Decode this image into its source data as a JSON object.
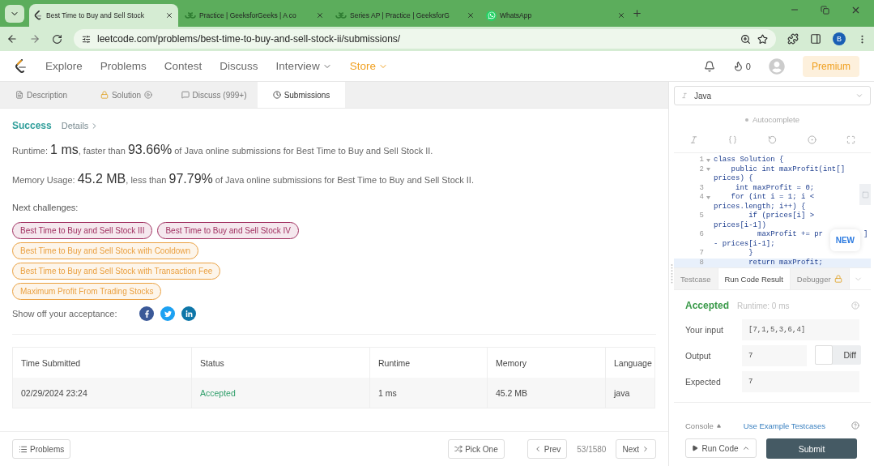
{
  "browser": {
    "tabs": [
      {
        "title": "Best Time to Buy and Sell Stock",
        "kind": "leetcode",
        "selected": true
      },
      {
        "title": "Practice | GeeksforGeeks | A co",
        "kind": "gfg",
        "selected": false
      },
      {
        "title": "Series AP | Practice | GeeksforG",
        "kind": "gfg",
        "selected": false
      },
      {
        "title": "WhatsApp",
        "kind": "whatsapp",
        "selected": false
      }
    ],
    "url": "leetcode.com/problems/best-time-to-buy-and-sell-stock-ii/submissions/",
    "profile": "B"
  },
  "nav": {
    "items": [
      {
        "label": "Explore",
        "dropdown": false,
        "featured": false
      },
      {
        "label": "Problems",
        "dropdown": false,
        "featured": false
      },
      {
        "label": "Contest",
        "dropdown": false,
        "featured": false
      },
      {
        "label": "Discuss",
        "dropdown": false,
        "featured": false
      },
      {
        "label": "Interview",
        "dropdown": true,
        "featured": false
      },
      {
        "label": "Store",
        "dropdown": true,
        "featured": true
      }
    ],
    "streak": "0",
    "premium": "Premium"
  },
  "panel_tabs": [
    {
      "label": "Description",
      "kind": "description",
      "selected": false
    },
    {
      "label": "Solution",
      "kind": "solution",
      "selected": false
    },
    {
      "label": "Discuss (999+)",
      "kind": "discuss",
      "selected": false
    },
    {
      "label": "Submissions",
      "kind": "submissions",
      "selected": true
    }
  ],
  "result": {
    "status": "Success",
    "details": "Details",
    "lines": [
      [
        {
          "text": "Runtime: ",
          "big": false
        },
        {
          "text": "1 ms",
          "big": true
        },
        {
          "text": ", faster than ",
          "big": false
        },
        {
          "text": "93.66%",
          "big": true
        },
        {
          "text": " of Java online submissions for Best Time to Buy and Sell Stock II.",
          "big": false
        }
      ],
      [
        {
          "text": "Memory Usage: ",
          "big": false
        },
        {
          "text": "45.2 MB",
          "big": true
        },
        {
          "text": ", less than ",
          "big": false
        },
        {
          "text": "97.79%",
          "big": true
        },
        {
          "text": " of Java online submissions for Best Time to Buy and Sell Stock II.",
          "big": false
        }
      ]
    ],
    "next_label": "Next challenges:",
    "challenges": [
      {
        "title": "Best Time to Buy and Sell Stock III",
        "color": "#a03060"
      },
      {
        "title": "Best Time to Buy and Sell Stock IV",
        "color": "#a03060"
      },
      {
        "title": "Best Time to Buy and Sell Stock with Cooldown",
        "color": "#eaa040"
      },
      {
        "title": "Best Time to Buy and Sell Stock with Transaction Fee",
        "color": "#eaa040"
      },
      {
        "title": "Maximum Profit From Trading Stocks",
        "color": "#eaa040"
      }
    ],
    "share_label": "Show off your acceptance:",
    "share": [
      {
        "kind": "facebook"
      },
      {
        "kind": "twitter"
      },
      {
        "kind": "linkedin"
      }
    ]
  },
  "table": {
    "columns": [
      "Time Submitted",
      "Status",
      "Runtime",
      "Memory",
      "Language"
    ],
    "rows": [
      {
        "time": "02/29/2024 23:24",
        "status": "Accepted",
        "runtime": "1 ms",
        "memory": "45.2 MB",
        "language": "java"
      }
    ]
  },
  "footer": {
    "problems": "Problems",
    "pick": "Pick One",
    "prev": "Prev",
    "counter": "53/1580",
    "next": "Next"
  },
  "editor": {
    "language": "Java",
    "autocomplete": {
      "label": "Autocomplete",
      "on": false
    },
    "lines": [
      {
        "number": "1",
        "fold": true,
        "current": false,
        "text": "class Solution {"
      },
      {
        "number": "2",
        "fold": true,
        "current": false,
        "text": "    public int maxProfit(int[]",
        "wrap": "prices) {"
      },
      {
        "number": "3",
        "fold": false,
        "current": false,
        "text": "     int maxProfit = 0;"
      },
      {
        "number": "4",
        "fold": true,
        "current": false,
        "text": "    for (int i = 1; i <",
        "wrap": "prices.length; i++) {"
      },
      {
        "number": "5",
        "fold": false,
        "current": false,
        "text": "        if (prices[i] >",
        "wrap": "prices[i-1])"
      },
      {
        "number": "6",
        "fold": false,
        "current": false,
        "text": "          maxProfit += pr",
        "tail": "]",
        "wrap": "- prices[i-1];"
      },
      {
        "number": "7",
        "fold": false,
        "current": false,
        "text": "        }"
      },
      {
        "number": "8",
        "fold": false,
        "current": true,
        "text": "        return maxProfit;"
      }
    ],
    "badge": "NEW"
  },
  "console": {
    "tabs": [
      {
        "label": "Testcase",
        "locked": false,
        "selected": false
      },
      {
        "label": "Run Code Result",
        "locked": false,
        "selected": true
      },
      {
        "label": "Debugger",
        "locked": true,
        "selected": false
      }
    ],
    "status": "Accepted",
    "runtime": "Runtime: 0 ms",
    "fields": [
      {
        "label": "Your input",
        "value": "[7,1,5,3,6,4]",
        "kind": "plain"
      },
      {
        "label": "Output",
        "value": "7",
        "kind": "compare"
      },
      {
        "label": "Expected",
        "value": "7",
        "kind": "plain"
      }
    ],
    "diff": {
      "label": "Diff",
      "on": false
    },
    "console_label": "Console",
    "example": "Use Example Testcases",
    "run": "Run Code",
    "submit": "Submit"
  }
}
